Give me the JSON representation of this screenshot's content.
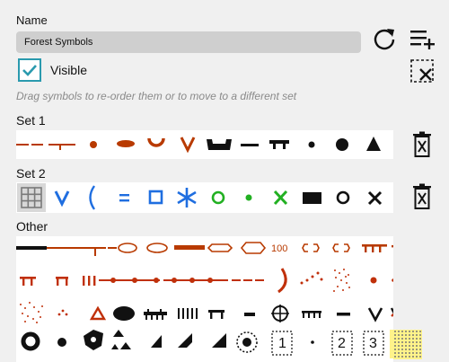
{
  "name_label": "Name",
  "name_value": "Forest Symbols",
  "visible_label": "Visible",
  "visible_checked": true,
  "hint": "Drag symbols to re-order them or to move to a different set",
  "set1_label": "Set 1",
  "set2_label": "Set 2",
  "other_label": "Other",
  "other_texts": {
    "hundred": "100",
    "one": "1",
    "two": "2",
    "three": "3"
  },
  "icons": {
    "refresh": "refresh-icon",
    "add_symbols": "playlist-add-icon",
    "clear_selection": "deselect-icon",
    "delete_set": "delete-icon"
  },
  "colors": {
    "accent": "#2a9aae",
    "set1_brown": "#b83a00",
    "set2_blue": "#1f6ee0",
    "set2_green": "#22b022",
    "other_red": "#c0300a",
    "yellow_fill": "#fff38a"
  }
}
